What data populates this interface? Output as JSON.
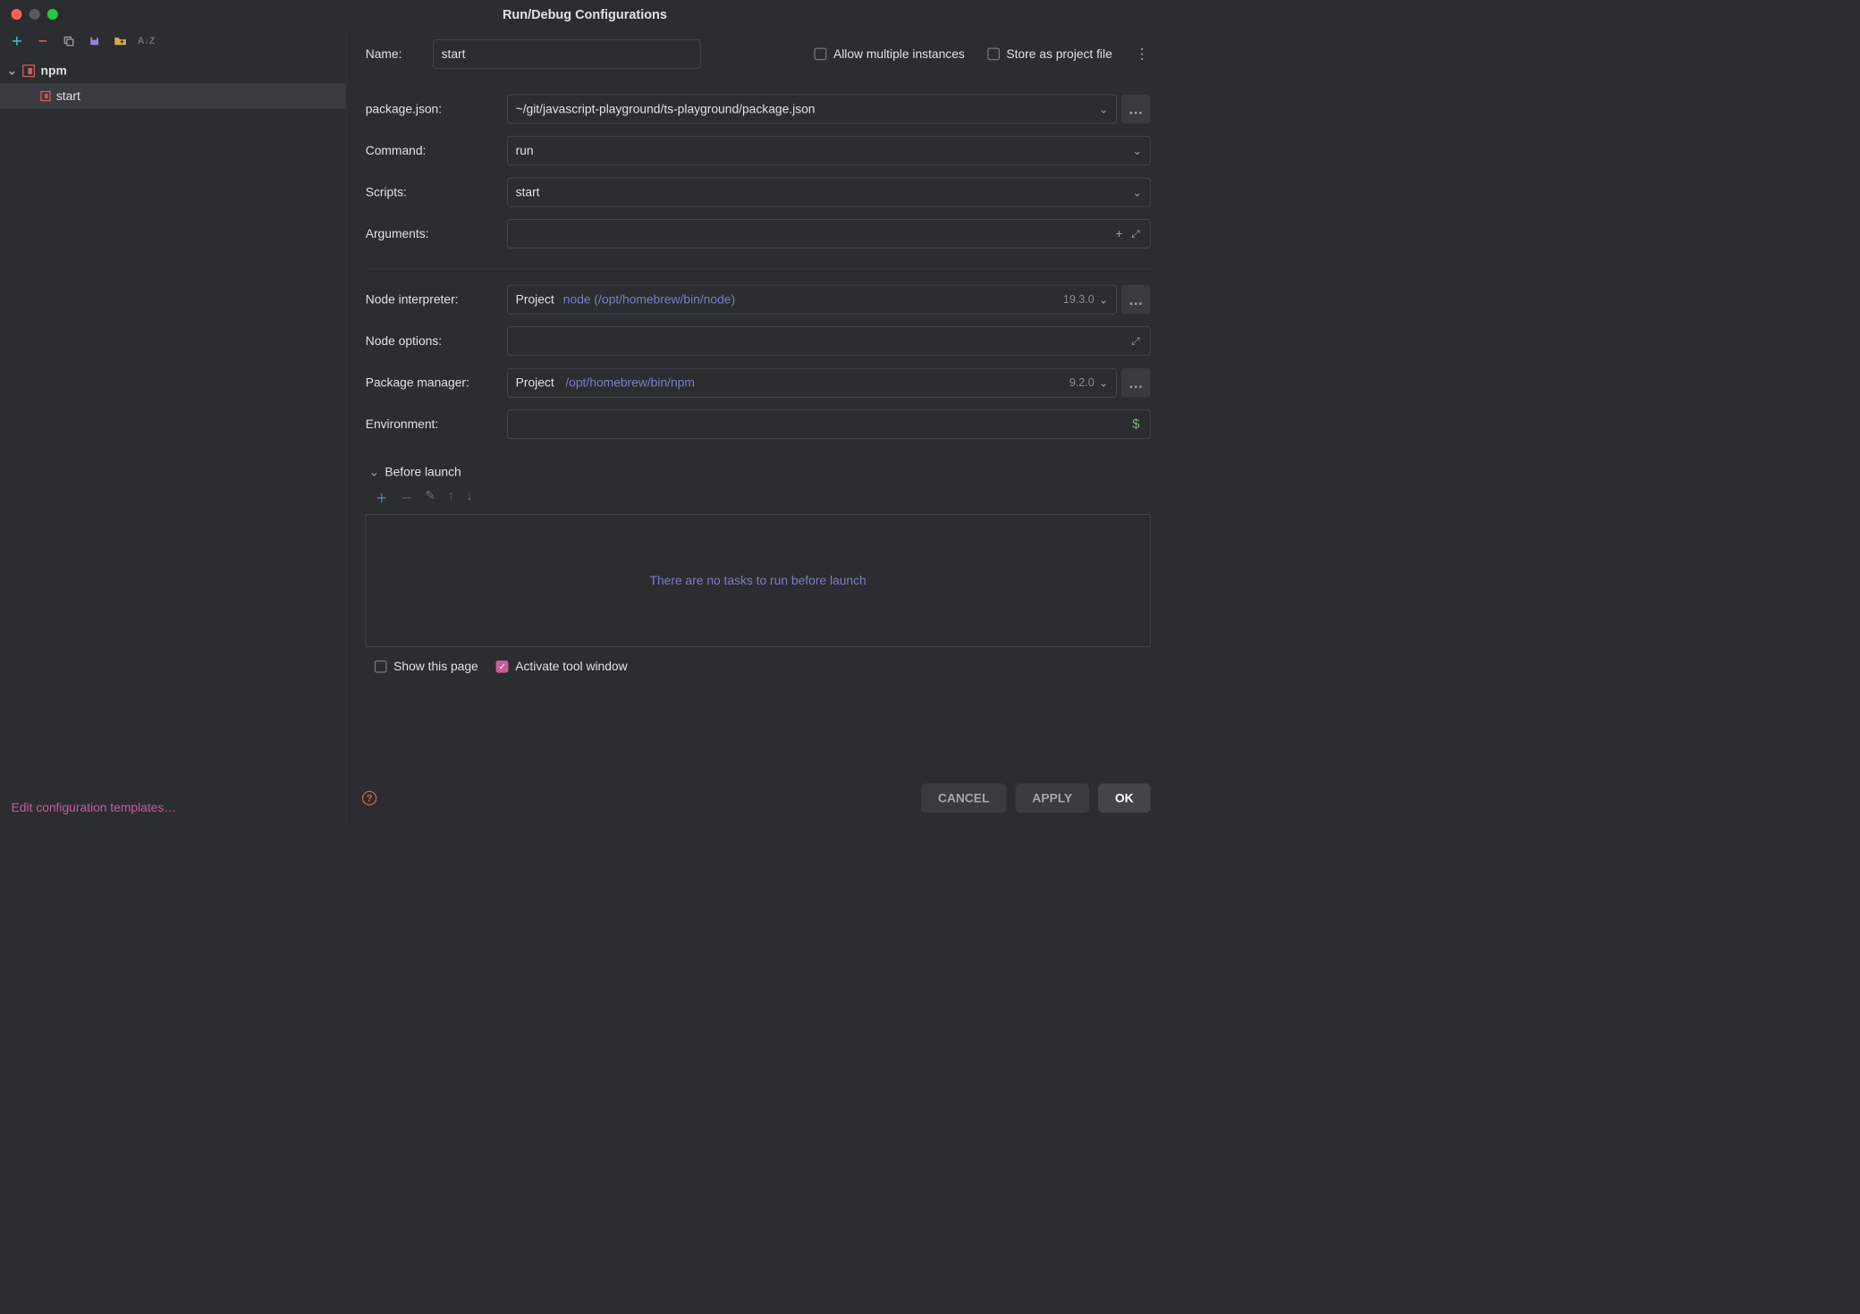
{
  "window": {
    "title": "Run/Debug Configurations"
  },
  "sidebar": {
    "group_label": "npm",
    "item_label": "start",
    "templates_link": "Edit configuration templates…"
  },
  "header": {
    "name_label": "Name:",
    "name_value": "start",
    "allow_multi_label": "Allow multiple instances",
    "allow_multi_checked": false,
    "store_project_label": "Store as project file",
    "store_project_checked": false
  },
  "fields": {
    "package_json_label": "package.json:",
    "package_json_value": "~/git/javascript-playground/ts-playground/package.json",
    "command_label": "Command:",
    "command_value": "run",
    "scripts_label": "Scripts:",
    "scripts_value": "start",
    "arguments_label": "Arguments:",
    "arguments_value": "",
    "node_interpreter_label": "Node interpreter:",
    "node_interpreter_prefix": "Project",
    "node_interpreter_path": "node (/opt/homebrew/bin/node)",
    "node_interpreter_version": "19.3.0",
    "node_options_label": "Node options:",
    "node_options_value": "",
    "package_manager_label": "Package manager:",
    "package_manager_prefix": "Project",
    "package_manager_path": "/opt/homebrew/bin/npm",
    "package_manager_version": "9.2.0",
    "environment_label": "Environment:",
    "environment_value": ""
  },
  "before_launch": {
    "title": "Before launch",
    "empty_text": "There are no tasks to run before launch"
  },
  "page_options": {
    "show_page_label": "Show this page",
    "show_page_checked": false,
    "activate_window_label": "Activate tool window",
    "activate_window_checked": true
  },
  "buttons": {
    "cancel": "CANCEL",
    "apply": "APPLY",
    "ok": "OK"
  }
}
